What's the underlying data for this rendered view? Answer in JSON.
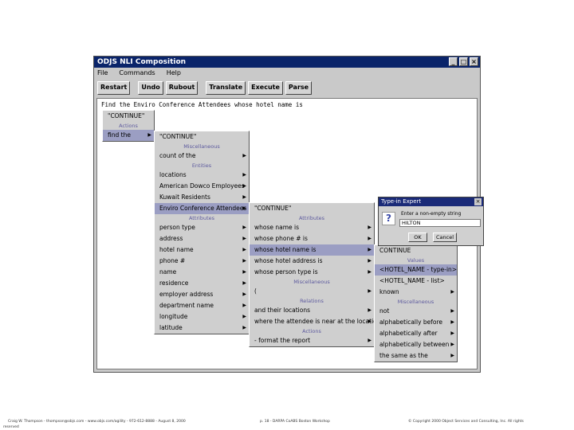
{
  "window": {
    "title": "ODJS NLI Composition",
    "controls": [
      "_",
      "□",
      "×"
    ],
    "menu": [
      "File",
      "Commands",
      "Help"
    ],
    "toolbar": [
      "Restart",
      "Undo",
      "Rubout",
      "Translate",
      "Execute",
      "Parse"
    ],
    "sentence": "Find the Enviro Conference Attendees whose hotel name is"
  },
  "menu1": {
    "items": [
      {
        "label": "\"CONTINUE\"",
        "type": "item",
        "arrow": false
      },
      {
        "label": "Actions",
        "type": "header"
      },
      {
        "label": "find the",
        "type": "item",
        "arrow": true,
        "highlight": true
      }
    ]
  },
  "menu2": {
    "items": [
      {
        "label": "\"CONTINUE\"",
        "type": "item",
        "arrow": false
      },
      {
        "label": "Miscellaneous",
        "type": "header"
      },
      {
        "label": "count of the",
        "type": "item",
        "arrow": true
      },
      {
        "label": "Entities",
        "type": "header"
      },
      {
        "label": "locations",
        "type": "item",
        "arrow": true
      },
      {
        "label": "American Dowco Employees",
        "type": "item",
        "arrow": true
      },
      {
        "label": "Kuwait Residents",
        "type": "item",
        "arrow": true
      },
      {
        "label": "Enviro Conference Attendees",
        "type": "item",
        "arrow": true,
        "highlight": true
      },
      {
        "label": "Attributes",
        "type": "header"
      },
      {
        "label": "person type",
        "type": "item",
        "arrow": true
      },
      {
        "label": "address",
        "type": "item",
        "arrow": true
      },
      {
        "label": "hotel name",
        "type": "item",
        "arrow": true
      },
      {
        "label": "phone #",
        "type": "item",
        "arrow": true
      },
      {
        "label": "name",
        "type": "item",
        "arrow": true
      },
      {
        "label": "residence",
        "type": "item",
        "arrow": true
      },
      {
        "label": "employer address",
        "type": "item",
        "arrow": true
      },
      {
        "label": "department name",
        "type": "item",
        "arrow": true
      },
      {
        "label": "longitude",
        "type": "item",
        "arrow": true
      },
      {
        "label": "latitude",
        "type": "item",
        "arrow": true
      }
    ]
  },
  "menu3": {
    "items": [
      {
        "label": "\"CONTINUE\"",
        "type": "item",
        "arrow": false
      },
      {
        "label": "Attributes",
        "type": "header"
      },
      {
        "label": "whose name is",
        "type": "item",
        "arrow": true
      },
      {
        "label": "whose phone # is",
        "type": "item",
        "arrow": true
      },
      {
        "label": "whose hotel name is",
        "type": "item",
        "arrow": true,
        "highlight": true
      },
      {
        "label": "whose hotel address is",
        "type": "item",
        "arrow": true
      },
      {
        "label": "whose person type is",
        "type": "item",
        "arrow": true
      },
      {
        "label": "Miscellaneous",
        "type": "header"
      },
      {
        "label": "(",
        "type": "item",
        "arrow": true
      },
      {
        "label": "Relations",
        "type": "header"
      },
      {
        "label": "and their locations",
        "type": "item",
        "arrow": true
      },
      {
        "label": "where the attendee is near at the location",
        "type": "item",
        "arrow": true
      },
      {
        "label": "Actions",
        "type": "header"
      },
      {
        "label": "- format the report",
        "type": "item",
        "arrow": true
      }
    ]
  },
  "menu4": {
    "items": [
      {
        "label": "CONTINUE",
        "type": "item",
        "arrow": false
      },
      {
        "label": "Values",
        "type": "header"
      },
      {
        "label": "<HOTEL_NAME - type-in>",
        "type": "item",
        "arrow": false,
        "highlight": true
      },
      {
        "label": "<HOTEL_NAME - list>",
        "type": "item",
        "arrow": false
      },
      {
        "label": "known",
        "type": "item",
        "arrow": true
      },
      {
        "label": "Miscellaneous",
        "type": "header"
      },
      {
        "label": "not",
        "type": "item",
        "arrow": true
      },
      {
        "label": "alphabetically before",
        "type": "item",
        "arrow": true
      },
      {
        "label": "alphabetically after",
        "type": "item",
        "arrow": true
      },
      {
        "label": "alphabetically between",
        "type": "item",
        "arrow": true
      },
      {
        "label": "the same as the",
        "type": "item",
        "arrow": true
      }
    ]
  },
  "dialog": {
    "title": "Type-in Expert",
    "prompt": "Enter a non-empty string",
    "value": "HILTON",
    "ok": "OK",
    "cancel": "Cancel"
  },
  "footer": {
    "left": "Craig W. Thompson - thompson@objs.com - www.objs.com/agility - 972-612-8888 - August 8, 2000",
    "left2": "reserved",
    "center": "p. 18 - DARPA CoABS Boston Workshop",
    "right": "© Copyright 2000 Object Services and Consulting, Inc. All rights"
  }
}
